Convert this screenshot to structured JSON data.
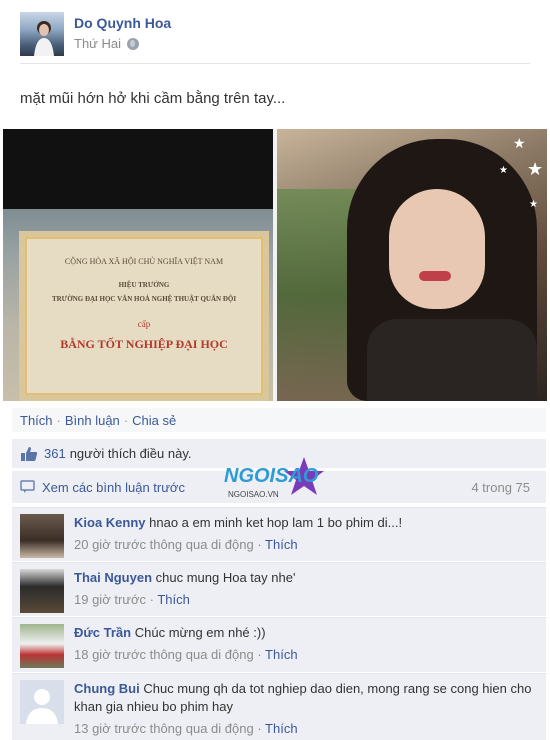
{
  "post": {
    "author": "Do Quynh Hoa",
    "time": "Thứ Hai",
    "text": "mặt mũi hớn hở khi cầm bằng trên tay..."
  },
  "diploma": {
    "line1": "CỘNG HÒA XÃ HỘI CHỦ NGHĨA VIỆT NAM",
    "line2": "HIỆU TRƯỞNG",
    "line3": "TRƯỜNG ĐẠI HỌC VĂN HOÁ NGHỆ THUẬT QUÂN ĐỘI",
    "line4": "cấp",
    "line5": "BẰNG TỐT NGHIỆP ĐẠI HỌC"
  },
  "actions": {
    "like": "Thích",
    "comment": "Bình luận",
    "share": "Chia sẻ",
    "separator": "·"
  },
  "likes": {
    "count": "361",
    "text": "người thích điều này."
  },
  "comments_bar": {
    "view_previous": "Xem các bình luận trước",
    "paging": "4 trong 75"
  },
  "watermark": {
    "brand": "NGOISAO",
    "site": "NGOISAO.VN"
  },
  "comments": [
    {
      "name": "Kioa Kenny",
      "text": "hnao a em minh ket hop lam 1 bo phim di...!",
      "time": "20 giờ trước thông qua di động",
      "like": "Thích"
    },
    {
      "name": "Thai Nguyen",
      "text": "chuc mung Hoa tay nhe'",
      "time": "19 giờ trước",
      "like": "Thích"
    },
    {
      "name": "Đức Trần",
      "text": "Chúc mừng em nhé :))",
      "time": "18 giờ trước thông qua di động",
      "like": "Thích"
    },
    {
      "name": "Chung Bui",
      "text": "Chuc mung qh da tot nghiep dao dien, mong rang se cong hien cho khan gia nhieu bo phim hay",
      "time": "13 giờ trước thông qua di động",
      "like": "Thích"
    }
  ],
  "colors": {
    "link": "#3b5998",
    "muted": "#8c8c8c",
    "panel": "#edeff4"
  }
}
